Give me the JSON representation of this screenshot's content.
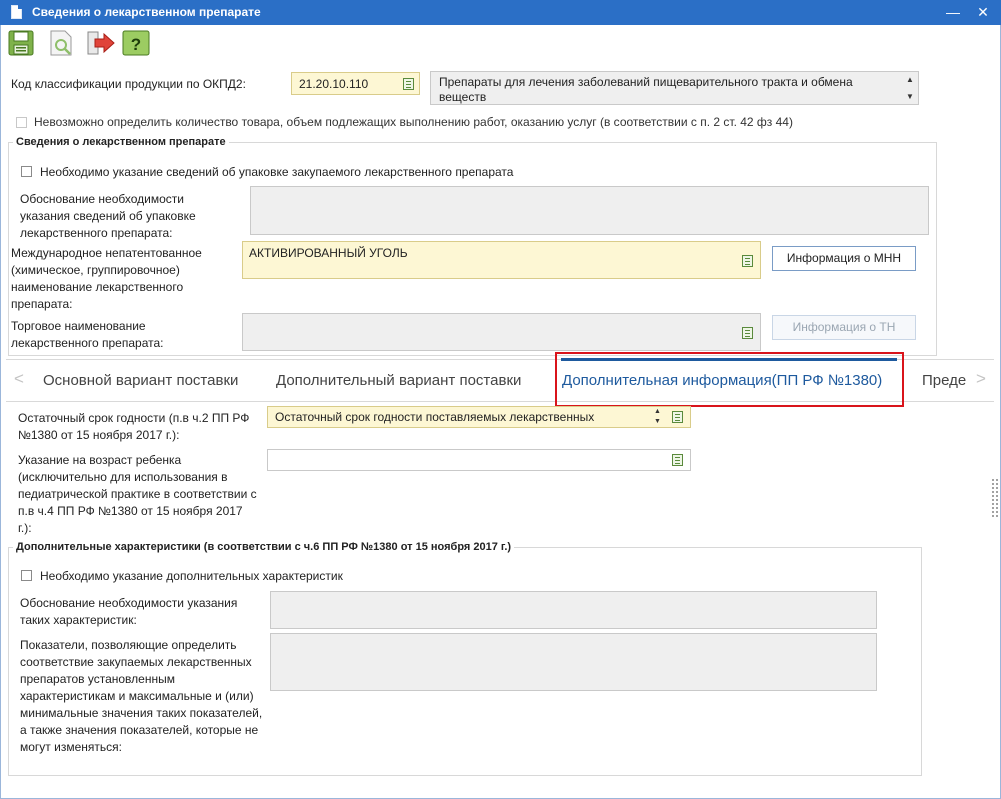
{
  "window": {
    "title": "Сведения о лекарственном препарате",
    "minimize": "—",
    "close": "✕"
  },
  "toolbar": {
    "items": [
      {
        "name": "save-icon"
      },
      {
        "name": "preview-icon"
      },
      {
        "name": "exit-icon"
      },
      {
        "name": "help-icon"
      }
    ]
  },
  "okpd": {
    "label": "Код классификации продукции по ОКПД2:",
    "code": "21.20.10.110",
    "description": "Препараты для лечения заболеваний пищеварительного тракта и обмена веществ"
  },
  "impossible_checkbox_label": "Невозможно определить количество товара, объем подлежащих выполнению работ, оказанию услуг (в соответствии с п. 2 ст. 42 фз 44)",
  "drug_group": {
    "title": "Сведения о лекарственном препарате",
    "packaging_checkbox_label": "Необходимо указание сведений об упаковке закупаемого лекарственного препарата",
    "packaging_reason_label": "Обоснование необходимости указания сведений об упаковке лекарственного препарата:",
    "inn_label": "Международное непатентованное (химическое, группировочное) наименование лекарственного препарата:",
    "inn_value": "АКТИВИРОВАННЫЙ УГОЛЬ",
    "inn_button": "Информация о МНН",
    "trade_name_label": "Торговое наименование лекарственного препарата:",
    "trade_name_button": "Информация о ТН"
  },
  "tabs": {
    "items": [
      {
        "label": "Основной вариант поставки"
      },
      {
        "label": "Дополнительный вариант поставки"
      },
      {
        "label": "Дополнительная информация(ПП РФ №1380)"
      },
      {
        "label": "Преде"
      }
    ]
  },
  "additional": {
    "shelf_life_label": "Остаточный срок годности (п.в ч.2 ПП РФ №1380 от 15 ноября 2017 г.):",
    "shelf_life_value": "Остаточный срок годности поставляемых лекарственных",
    "child_age_label": "Указание на возраст ребенка (исключительно для использования в педиатрической практике в соответствии с п.в ч.4 ПП РФ №1380 от 15 ноября 2017 г.):"
  },
  "char_group": {
    "title": "Дополнительные характеристики (в соответствии с ч.6 ПП РФ №1380 от 15 ноября 2017 г.)",
    "checkbox_label": "Необходимо указание дополнительных характеристик",
    "reason_label": "Обоснование необходимости указания таких характеристик:",
    "indicators_label": "Показатели, позволяющие определить соответствие закупаемых лекарственных препаратов установленным характеристикам и максимальные и (или) минимальные значения таких показателей, а также значения показателей, которые не могут изменяться:"
  },
  "colors": {
    "titlebar": "#2b6fc6",
    "yellow_field": "#fdf7d4",
    "highlight": "#d9141b",
    "tab_active": "#1e5a9e"
  }
}
